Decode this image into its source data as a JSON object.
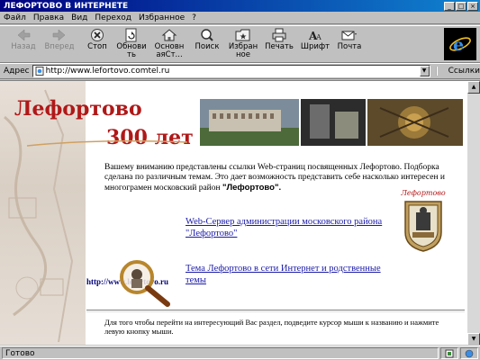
{
  "window": {
    "title": "ЛЕФОРТОВО В ИНТЕРНЕТЕ",
    "minimize": "_",
    "maximize": "□",
    "close": "×"
  },
  "menu": [
    "Файл",
    "Правка",
    "Вид",
    "Переход",
    "Избранное",
    "?"
  ],
  "toolbar": {
    "back": "Назад",
    "forward": "Вперед",
    "stop": "Стоп",
    "refresh": "Обнови ть",
    "home": "Основн аяСт...",
    "search": "Поиск",
    "favorites": "Избран ное",
    "print": "Печать",
    "font": "Шрифт",
    "mail": "Почта"
  },
  "address": {
    "label": "Адрес",
    "url": "http://www.lefortovo.comtel.ru",
    "links_label": "Ссылки"
  },
  "page": {
    "logo_text_main": "Лефортово",
    "logo_text_sub": "300 лет",
    "intro_text": "Вашему вниманию представлены ссылки  Web-страниц  посвященных Лефортово. Подборка сделана по различным темам.   Это дает возможность представить себе насколько интересен и многограмен московский район ",
    "intro_bold": "\"Лефортово\".",
    "link1": "Web-Сервер администрации московского района \"Лефортово\"",
    "link2": "Тема Лефортово в сети Интернет и родственные темы",
    "url_label": "http://www.lefortovo.ru",
    "emblem_label": "Лефортово",
    "footer_note": "Для того чтобы перейти на интересующий Вас раздел, подведите  курсор мыши к названию и нажмите левую кнопку мыши."
  },
  "status": {
    "text": "Готово"
  }
}
